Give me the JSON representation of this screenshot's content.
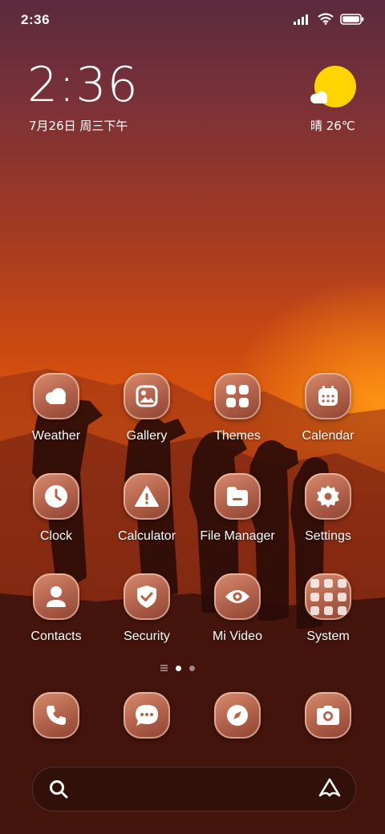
{
  "status_bar": {
    "time": "2:36"
  },
  "clock_widget": {
    "time": "2:36",
    "date": "7月26日 周三下午"
  },
  "weather_widget": {
    "text": "晴 26℃"
  },
  "apps": [
    {
      "label": "Weather",
      "icon": "cloud-icon"
    },
    {
      "label": "Gallery",
      "icon": "image-icon"
    },
    {
      "label": "Themes",
      "icon": "grid-icon"
    },
    {
      "label": "Calendar",
      "icon": "calendar-icon"
    },
    {
      "label": "Clock",
      "icon": "clock-icon"
    },
    {
      "label": "Calculator",
      "icon": "warning-icon"
    },
    {
      "label": "File Manager",
      "icon": "folder-icon"
    },
    {
      "label": "Settings",
      "icon": "gear-icon"
    },
    {
      "label": "Contacts",
      "icon": "person-icon"
    },
    {
      "label": "Security",
      "icon": "shield-check-icon"
    },
    {
      "label": "Mi Video",
      "icon": "eye-icon"
    },
    {
      "label": "System",
      "icon": "folder-grid-icon"
    }
  ],
  "page_indicator": {
    "pages": 2,
    "current": 1
  },
  "dock": [
    {
      "icon": "phone-icon"
    },
    {
      "icon": "message-icon"
    },
    {
      "icon": "compass-icon"
    },
    {
      "icon": "camera-icon"
    }
  ],
  "search": {
    "left_icon": "search-icon",
    "right_icon": "assistant-icon"
  }
}
